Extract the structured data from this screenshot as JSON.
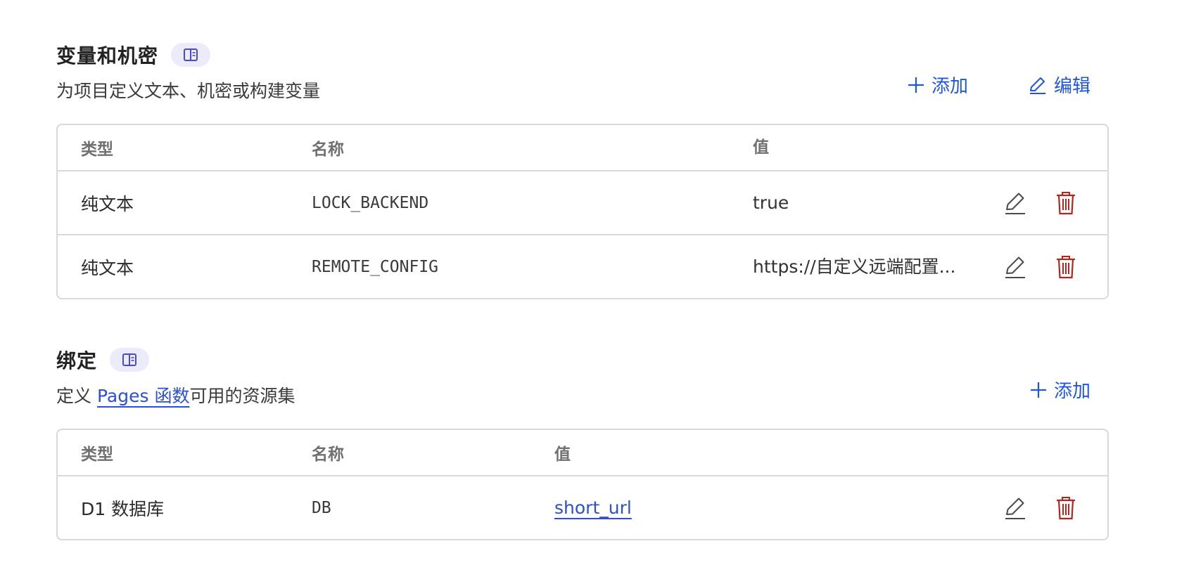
{
  "variables": {
    "title": "变量和机密",
    "subtitle": "为项目定义文本、机密或构建变量",
    "add_label": "添加",
    "edit_label": "编辑",
    "columns": [
      "类型",
      "名称",
      "值"
    ],
    "rows": [
      {
        "type": "纯文本",
        "name": "LOCK_BACKEND",
        "value": "true"
      },
      {
        "type": "纯文本",
        "name": "REMOTE_CONFIG",
        "value": "https://自定义远端配置..."
      }
    ]
  },
  "bindings": {
    "title": "绑定",
    "subtitle_prefix": "定义 ",
    "subtitle_link": "Pages 函数",
    "subtitle_suffix": "可用的资源集",
    "add_label": "添加",
    "columns": [
      "类型",
      "名称",
      "值"
    ],
    "rows": [
      {
        "type": "D1 数据库",
        "name": "DB",
        "value": "short_url"
      }
    ]
  },
  "colors": {
    "accent": "#1f55e0",
    "link": "#2b4fd6",
    "danger": "#b3261e",
    "badge_bg": "#ecebfb"
  },
  "icons": [
    "book-icon",
    "plus-icon",
    "pencil-icon",
    "trash-icon"
  ]
}
